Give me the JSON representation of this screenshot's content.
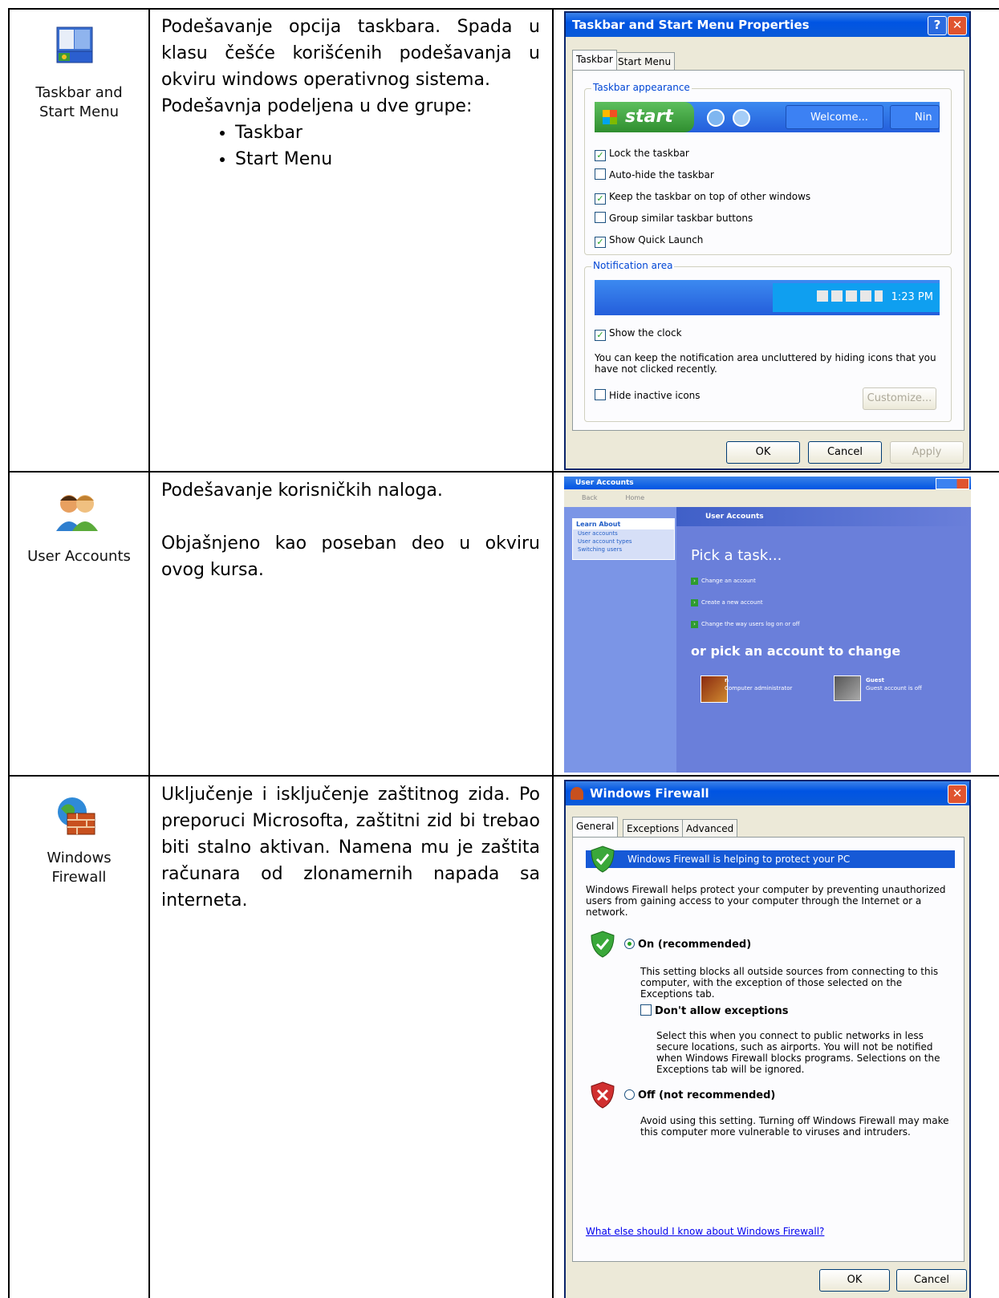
{
  "rows": [
    {
      "icon_label": [
        "Taskbar and",
        "Start Menu"
      ],
      "description": "Podešavanje opcija taskbara. Spada u klasu češće korišćenih podešavanja u okviru windows operativnog sistema.",
      "description_extra": "Podešavnja podeljena u dve grupe:",
      "bullets": [
        "Taskbar",
        "Start Menu"
      ]
    },
    {
      "icon_label": [
        "User Accounts"
      ],
      "description": "Podešavanje korisničkih naloga.",
      "description_extra": "Objašnjeno kao poseban deo u okviru ovog kursa."
    },
    {
      "icon_label": [
        "Windows",
        "Firewall"
      ],
      "description": "Uključenje i isključenje zaštitnog zida. Po preporuci Microsofta, zaštitni zid bi trebao biti stalno aktivan. Namena mu je zaštita računara od zlonamernih napada sa interneta."
    }
  ],
  "taskbar_dialog": {
    "title": "Taskbar and Start Menu Properties",
    "help_btn": "?",
    "close_btn": "✕",
    "tabs": [
      "Taskbar",
      "Start Menu"
    ],
    "appearance_legend": "Taskbar appearance",
    "start_label": "start",
    "task_buttons": [
      "Welcome...",
      "Nin"
    ],
    "options": [
      {
        "label": "Lock the taskbar",
        "checked": "✓"
      },
      {
        "label": "Auto-hide the taskbar",
        "checked": ""
      },
      {
        "label": "Keep the taskbar on top of other windows",
        "checked": "✓"
      },
      {
        "label": "Group similar taskbar buttons",
        "checked": ""
      },
      {
        "label": "Show Quick Launch",
        "checked": "✓"
      }
    ],
    "notification_legend": "Notification area",
    "clock": "1:23 PM",
    "show_clock": "Show the clock",
    "show_clock_checked": "✓",
    "notif_text": "You can keep the notification area uncluttered by hiding icons that you have not clicked recently.",
    "hide_inactive": "Hide inactive icons",
    "customize": "Customize...",
    "ok": "OK",
    "cancel": "Cancel",
    "apply": "Apply"
  },
  "user_accounts": {
    "title": "User Accounts",
    "back": "Back",
    "home": "Home",
    "learn_about": "Learn About",
    "learn_links": [
      "User accounts",
      "User account types",
      "Switching users"
    ],
    "header": "User Accounts",
    "pick_task": "Pick a task...",
    "tasks": [
      "Change an account",
      "Create a new account",
      "Change the way users log on or off"
    ],
    "pick_account": "or pick an account to change",
    "accounts": [
      {
        "name": "n",
        "desc": "Computer administrator"
      },
      {
        "name": "Guest",
        "desc": "Guest account is off"
      }
    ]
  },
  "firewall": {
    "title": "Windows Firewall",
    "close_btn": "✕",
    "tabs": [
      "General",
      "Exceptions",
      "Advanced"
    ],
    "banner": "Windows Firewall is helping to protect your PC",
    "intro": "Windows Firewall helps protect your computer by preventing unauthorized users from gaining access to your computer through the Internet or a network.",
    "on_label": "On (recommended)",
    "on_desc": "This setting blocks all outside sources from connecting to this computer, with the exception of those selected on the Exceptions tab.",
    "dont_allow": "Don't allow exceptions",
    "dont_allow_desc": "Select this when you connect to public networks in less secure locations, such as airports. You will not be notified when Windows Firewall blocks programs. Selections on the Exceptions tab will be ignored.",
    "off_label": "Off (not recommended)",
    "off_desc": "Avoid using this setting. Turning off Windows Firewall may make this computer more vulnerable to viruses and intruders.",
    "link": "What else should I know about Windows Firewall?",
    "ok": "OK",
    "cancel": "Cancel"
  }
}
